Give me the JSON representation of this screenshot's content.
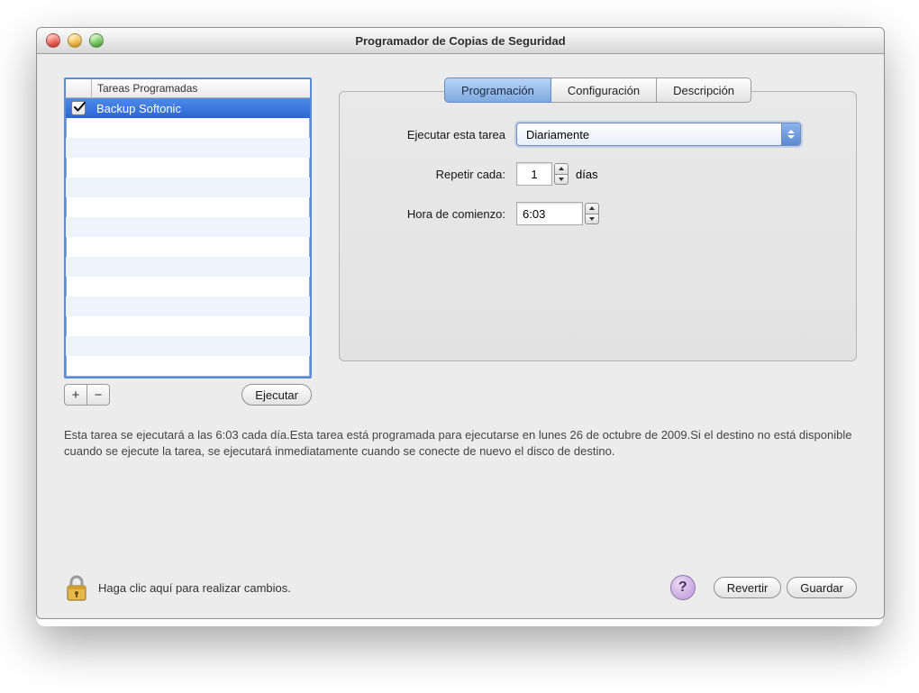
{
  "window": {
    "title": "Programador de Copias de Seguridad"
  },
  "sidebar": {
    "header_label": "Tareas Programadas",
    "items": [
      {
        "label": "Backup Softonic",
        "checked": true,
        "selected": true
      }
    ],
    "add_label": "+",
    "remove_label": "−",
    "run_label": "Ejecutar"
  },
  "tabs": {
    "programacion": "Programación",
    "configuracion": "Configuración",
    "descripcion": "Descripción",
    "active": "programacion"
  },
  "form": {
    "run_task_label": "Ejecutar esta tarea",
    "run_task_value": "Diariamente",
    "repeat_label": "Repetir cada:",
    "repeat_value": "1",
    "repeat_unit": "días",
    "start_time_label": "Hora de comienzo:",
    "start_time_value": "6:03"
  },
  "description_text": "Esta tarea se ejecutará a las 6:03 cada día.Esta tarea está programada para ejecutarse en lunes 26 de octubre de 2009.Si el destino no está disponible cuando se ejecute la tarea, se ejecutará inmediatamente cuando se conecte de nuevo el disco de destino.",
  "footer": {
    "lock_text": "Haga clic aquí para realizar cambios.",
    "help_label": "?",
    "revert_label": "Revertir",
    "save_label": "Guardar"
  }
}
